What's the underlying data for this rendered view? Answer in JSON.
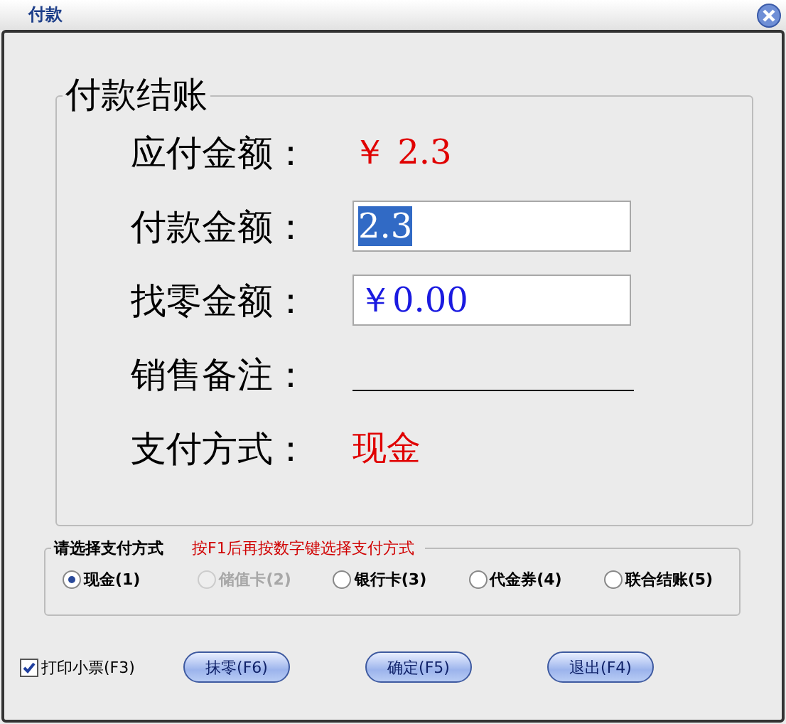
{
  "window": {
    "title": "付款"
  },
  "checkout": {
    "legend": "付款结账",
    "rows": [
      {
        "label": "应付金额：",
        "kind": "text",
        "value": "￥ 2.3"
      },
      {
        "label": "付款金额：",
        "kind": "input",
        "value": "2.3",
        "selected": true
      },
      {
        "label": "找零金额：",
        "kind": "input",
        "value": "￥0.00",
        "selected": false
      },
      {
        "label": "销售备注：",
        "kind": "line"
      },
      {
        "label": "支付方式：",
        "kind": "text",
        "value": "现金"
      }
    ]
  },
  "payment": {
    "legend": "请选择支付方式",
    "hint": "按F1后再按数字键选择支付方式",
    "options": [
      {
        "label": "现金(1)",
        "selected": true,
        "disabled": false
      },
      {
        "label": "储值卡(2)",
        "selected": false,
        "disabled": true
      },
      {
        "label": "银行卡(3)",
        "selected": false,
        "disabled": false
      },
      {
        "label": "代金券(4)",
        "selected": false,
        "disabled": false
      },
      {
        "label": "联合结账(5)",
        "selected": false,
        "disabled": false
      }
    ]
  },
  "print_receipt": {
    "label": "打印小票(F3)",
    "checked": true
  },
  "buttons": [
    "抹零(F6)",
    "确定(F5)",
    "退出(F4)"
  ]
}
